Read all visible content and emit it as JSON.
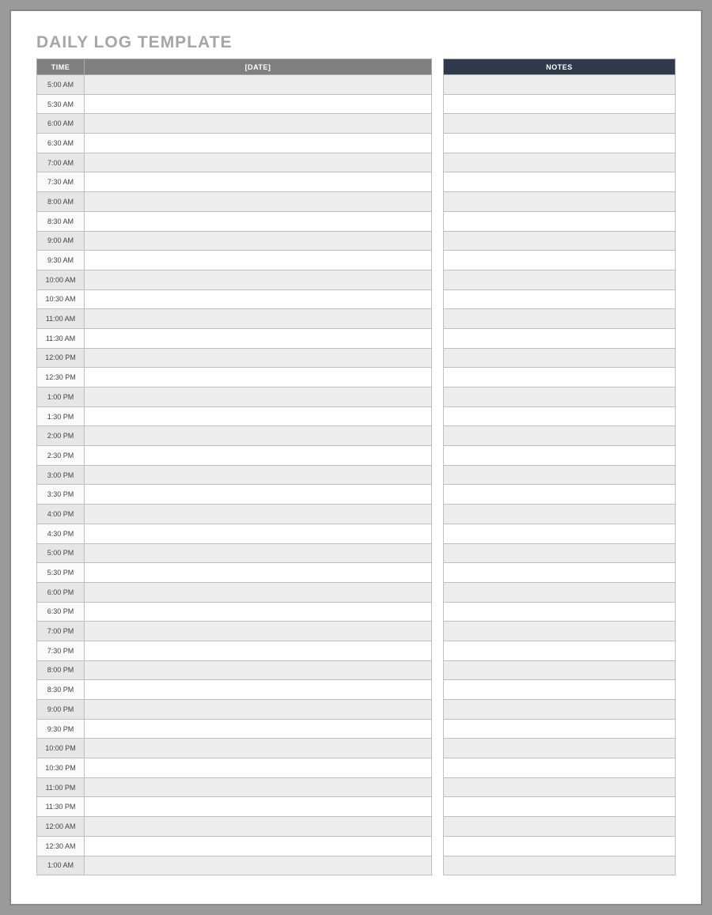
{
  "title": "DAILY LOG TEMPLATE",
  "headers": {
    "time": "TIME",
    "date": "[DATE]",
    "notes": "NOTES"
  },
  "rows": [
    {
      "time": "5:00 AM",
      "entry": "",
      "note": "",
      "alt": true
    },
    {
      "time": "5:30 AM",
      "entry": "",
      "note": "",
      "alt": false
    },
    {
      "time": "6:00 AM",
      "entry": "",
      "note": "",
      "alt": true
    },
    {
      "time": "6:30 AM",
      "entry": "",
      "note": "",
      "alt": false
    },
    {
      "time": "7:00 AM",
      "entry": "",
      "note": "",
      "alt": true
    },
    {
      "time": "7:30 AM",
      "entry": "",
      "note": "",
      "alt": false
    },
    {
      "time": "8:00 AM",
      "entry": "",
      "note": "",
      "alt": true
    },
    {
      "time": "8:30 AM",
      "entry": "",
      "note": "",
      "alt": false
    },
    {
      "time": "9:00 AM",
      "entry": "",
      "note": "",
      "alt": true
    },
    {
      "time": "9:30 AM",
      "entry": "",
      "note": "",
      "alt": false
    },
    {
      "time": "10:00 AM",
      "entry": "",
      "note": "",
      "alt": true
    },
    {
      "time": "10:30 AM",
      "entry": "",
      "note": "",
      "alt": false
    },
    {
      "time": "11:00 AM",
      "entry": "",
      "note": "",
      "alt": true
    },
    {
      "time": "11:30 AM",
      "entry": "",
      "note": "",
      "alt": false
    },
    {
      "time": "12:00 PM",
      "entry": "",
      "note": "",
      "alt": true
    },
    {
      "time": "12:30 PM",
      "entry": "",
      "note": "",
      "alt": false
    },
    {
      "time": "1:00 PM",
      "entry": "",
      "note": "",
      "alt": true
    },
    {
      "time": "1:30 PM",
      "entry": "",
      "note": "",
      "alt": false
    },
    {
      "time": "2:00 PM",
      "entry": "",
      "note": "",
      "alt": true
    },
    {
      "time": "2:30 PM",
      "entry": "",
      "note": "",
      "alt": false
    },
    {
      "time": "3:00 PM",
      "entry": "",
      "note": "",
      "alt": true
    },
    {
      "time": "3:30 PM",
      "entry": "",
      "note": "",
      "alt": false
    },
    {
      "time": "4:00 PM",
      "entry": "",
      "note": "",
      "alt": true
    },
    {
      "time": "4:30 PM",
      "entry": "",
      "note": "",
      "alt": false
    },
    {
      "time": "5:00 PM",
      "entry": "",
      "note": "",
      "alt": true
    },
    {
      "time": "5:30 PM",
      "entry": "",
      "note": "",
      "alt": false
    },
    {
      "time": "6:00 PM",
      "entry": "",
      "note": "",
      "alt": true
    },
    {
      "time": "6:30 PM",
      "entry": "",
      "note": "",
      "alt": false
    },
    {
      "time": "7:00 PM",
      "entry": "",
      "note": "",
      "alt": true
    },
    {
      "time": "7:30 PM",
      "entry": "",
      "note": "",
      "alt": false
    },
    {
      "time": "8:00 PM",
      "entry": "",
      "note": "",
      "alt": true
    },
    {
      "time": "8:30 PM",
      "entry": "",
      "note": "",
      "alt": false
    },
    {
      "time": "9:00 PM",
      "entry": "",
      "note": "",
      "alt": true
    },
    {
      "time": "9:30 PM",
      "entry": "",
      "note": "",
      "alt": false
    },
    {
      "time": "10:00 PM",
      "entry": "",
      "note": "",
      "alt": true
    },
    {
      "time": "10:30 PM",
      "entry": "",
      "note": "",
      "alt": false
    },
    {
      "time": "11:00 PM",
      "entry": "",
      "note": "",
      "alt": true
    },
    {
      "time": "11:30 PM",
      "entry": "",
      "note": "",
      "alt": false
    },
    {
      "time": "12:00 AM",
      "entry": "",
      "note": "",
      "alt": true
    },
    {
      "time": "12:30 AM",
      "entry": "",
      "note": "",
      "alt": false
    },
    {
      "time": "1:00 AM",
      "entry": "",
      "note": "",
      "alt": true
    }
  ]
}
